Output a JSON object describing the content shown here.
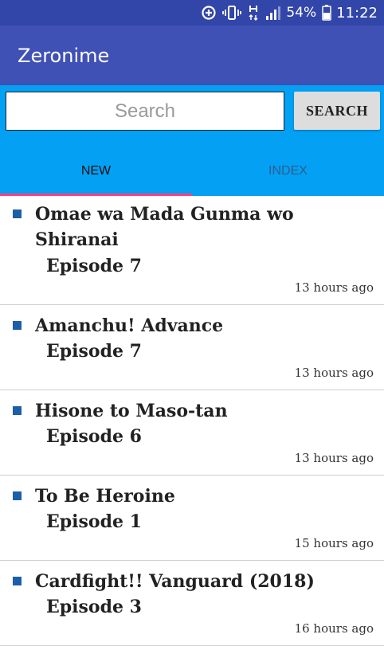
{
  "status_bar": {
    "battery": "54%",
    "time": "11:22",
    "icons": [
      "data-saver-icon",
      "vibrate-icon",
      "network-h-icon",
      "signal-icon",
      "battery-icon"
    ]
  },
  "app": {
    "title": "Zeronime"
  },
  "search": {
    "placeholder": "Search",
    "value": "",
    "button_label": "SEARCH"
  },
  "tabs": [
    {
      "label": "NEW",
      "active": true
    },
    {
      "label": "INDEX",
      "active": false
    }
  ],
  "colors": {
    "status_bar": "#3245a8",
    "app_bar": "#3f51b5",
    "panel": "#03a0f4",
    "tab_indicator": "#ff4081",
    "bullet": "#1d5ea8"
  },
  "items": [
    {
      "title": "Omae wa Mada Gunma wo Shiranai",
      "episode": "Episode 7",
      "time": "13 hours ago"
    },
    {
      "title": "Amanchu! Advance",
      "episode": "Episode 7",
      "time": "13 hours ago"
    },
    {
      "title": "Hisone to Maso-tan",
      "episode": "Episode 6",
      "time": "13 hours ago"
    },
    {
      "title": "To Be Heroine",
      "episode": "Episode 1",
      "time": "15 hours ago"
    },
    {
      "title": "Cardfight!! Vanguard (2018)",
      "episode": "Episode 3",
      "time": "16 hours ago"
    }
  ]
}
